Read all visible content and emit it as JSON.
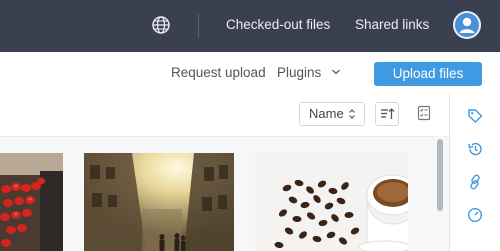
{
  "header": {
    "checked_out_label": "Checked-out files",
    "shared_links_label": "Shared links",
    "icons": [
      "globe-icon",
      "user-avatar-icon"
    ]
  },
  "actions": {
    "request_upload_label": "Request upload",
    "plugins_label": "Plugins",
    "upload_files_label": "Upload files"
  },
  "toolbar": {
    "sort_value": "Name",
    "icons": [
      "sort-direction-icon",
      "select-list-icon"
    ]
  },
  "thumbnails": [
    {
      "subject": "red lanterns street"
    },
    {
      "subject": "sunlit alley"
    },
    {
      "subject": "coffee cup with beans"
    }
  ],
  "sidebar": {
    "icons": [
      "tag-icon",
      "history-icon",
      "link-icon",
      "clock-icon"
    ]
  },
  "colors": {
    "header_bg": "#3b4051",
    "accent": "#3e9ae2",
    "sidebar_icon": "#3e9ae2"
  }
}
